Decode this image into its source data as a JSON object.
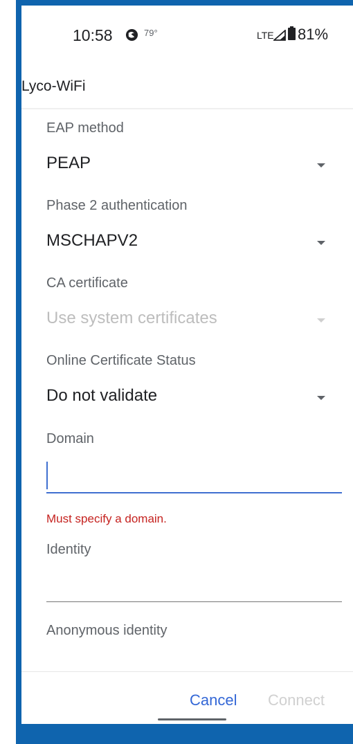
{
  "status_bar": {
    "time": "10:58",
    "weather_icon": "firefox-icon",
    "temperature": "79°",
    "network": "LTE",
    "signal_icon": "signal-icon",
    "battery_icon": "battery-icon",
    "battery": "81%"
  },
  "dialog": {
    "title": "Lyco-WiFi"
  },
  "fields": {
    "eap_method": {
      "label": "EAP method",
      "value": "PEAP"
    },
    "phase2": {
      "label": "Phase 2 authentication",
      "value": "MSCHAPV2"
    },
    "ca_certificate": {
      "label": "CA certificate",
      "value": "Use system certificates"
    },
    "ocsp": {
      "label": "Online Certificate Status",
      "value": "Do not validate"
    },
    "domain": {
      "label": "Domain",
      "value": "",
      "error": "Must specify a domain."
    },
    "identity": {
      "label": "Identity",
      "value": ""
    },
    "anonymous_identity": {
      "label": "Anonymous identity"
    }
  },
  "actions": {
    "cancel": "Cancel",
    "connect": "Connect"
  },
  "colors": {
    "accent": "#3367d6",
    "error": "#c5221f",
    "frame": "#0f64ae"
  }
}
